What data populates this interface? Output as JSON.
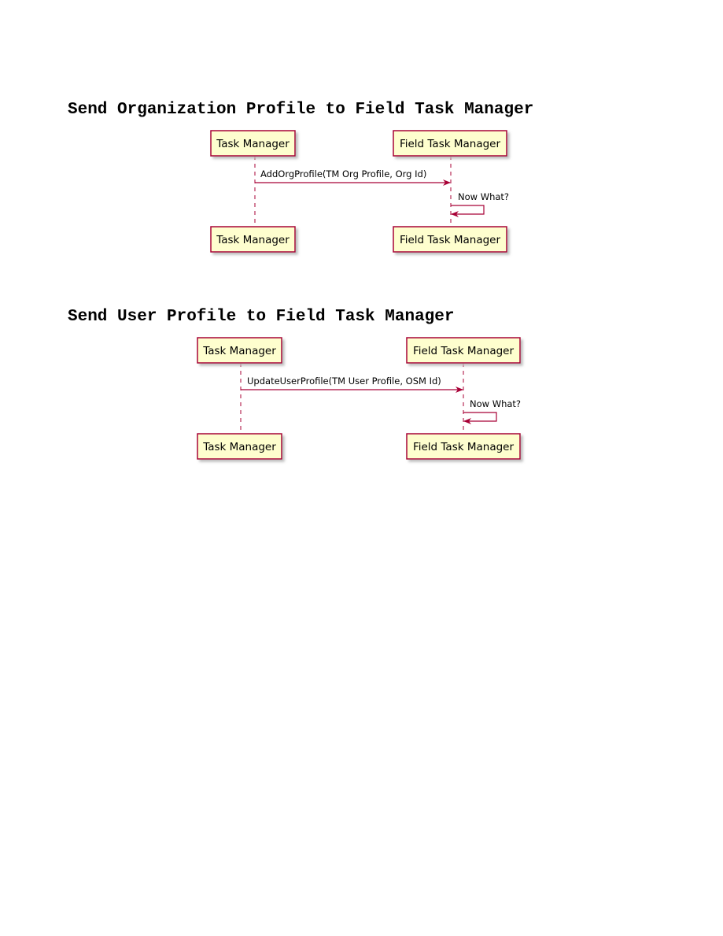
{
  "colors": {
    "box_fill": "#fefece",
    "box_border": "#a80036",
    "lifeline": "#a80036",
    "arrow": "#a80036",
    "shadow": "#b8b8b8"
  },
  "diagrams": [
    {
      "title": "Send Organization Profile to Field Task Manager",
      "participants": [
        {
          "name": "Task Manager"
        },
        {
          "name": "Field Task Manager"
        }
      ],
      "messages": [
        {
          "from": "Task Manager",
          "to": "Field Task Manager",
          "label": "AddOrgProfile(TM Org Profile, Org Id)"
        },
        {
          "from": "Field Task Manager",
          "to": "Field Task Manager",
          "label": "Now What?"
        }
      ]
    },
    {
      "title": "Send User Profile to Field Task Manager",
      "participants": [
        {
          "name": "Task Manager"
        },
        {
          "name": "Field Task Manager"
        }
      ],
      "messages": [
        {
          "from": "Task Manager",
          "to": "Field Task Manager",
          "label": "UpdateUserProfile(TM User Profile, OSM Id)"
        },
        {
          "from": "Field Task Manager",
          "to": "Field Task Manager",
          "label": "Now What?"
        }
      ]
    }
  ]
}
